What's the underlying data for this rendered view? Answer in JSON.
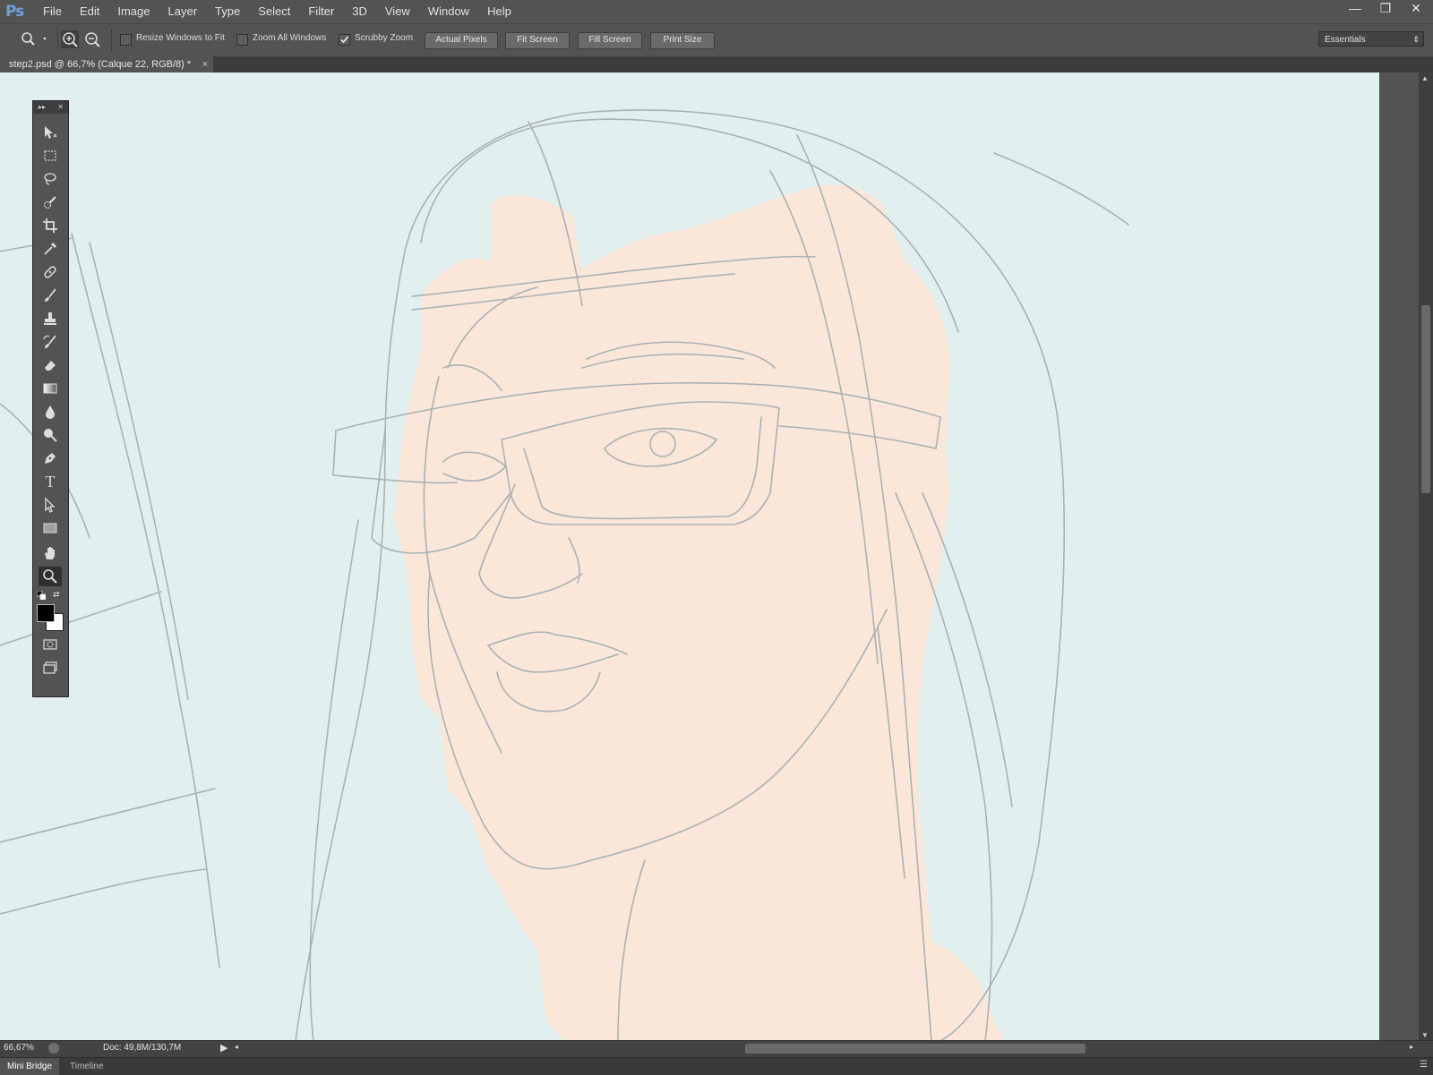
{
  "app": {
    "logo": "Ps"
  },
  "menu": [
    "File",
    "Edit",
    "Image",
    "Layer",
    "Type",
    "Select",
    "Filter",
    "3D",
    "View",
    "Window",
    "Help"
  ],
  "window_controls": {
    "minimize": "—",
    "restore": "❐",
    "close": "✕"
  },
  "options": {
    "resize_windows": "Resize Windows to Fit",
    "zoom_all": "Zoom All Windows",
    "scrubby_zoom": "Scrubby Zoom",
    "scrubby_checked": true,
    "actual_pixels": "Actual Pixels",
    "fit_screen": "Fit Screen",
    "fill_screen": "Fill Screen",
    "print_size": "Print Size",
    "workspace": "Essentials"
  },
  "document": {
    "tab_title": "step2.psd @ 66,7% (Calque 22, RGB/8) *",
    "close": "×"
  },
  "toolbox": {
    "tools": [
      "move-tool",
      "marquee-tool",
      "lasso-tool",
      "quick-selection-tool",
      "crop-tool",
      "eyedropper-tool",
      "healing-brush-tool",
      "brush-tool",
      "clone-stamp-tool",
      "history-brush-tool",
      "eraser-tool",
      "gradient-tool",
      "blur-tool",
      "dodge-tool",
      "pen-tool",
      "type-tool",
      "path-selection-tool",
      "rectangle-tool",
      "hand-tool",
      "zoom-tool"
    ],
    "active_tool": "zoom-tool",
    "foreground_color": "#000000",
    "background_color": "#ffffff",
    "type_glyph": "T"
  },
  "status": {
    "zoom": "66,67%",
    "doc_size": "Doc: 49,8M/130,7M"
  },
  "panels": [
    "Mini Bridge",
    "Timeline"
  ],
  "colors": {
    "canvas_bg": "#e1efef",
    "skin": "#fbe6da",
    "sketch": "#a9b2b2"
  }
}
